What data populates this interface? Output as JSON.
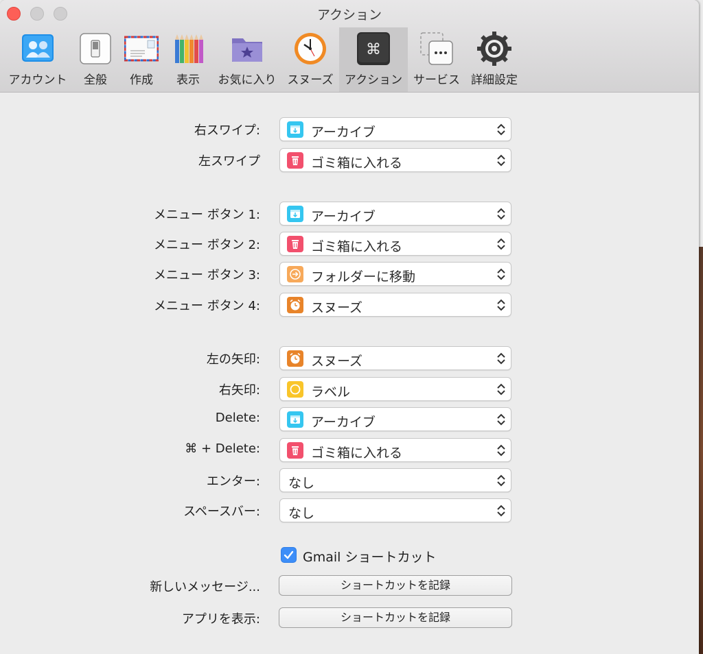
{
  "window": {
    "title": "アクション"
  },
  "tabs": [
    {
      "label": "アカウント",
      "icon": "accounts-icon"
    },
    {
      "label": "全般",
      "icon": "general-switch-icon"
    },
    {
      "label": "作成",
      "icon": "envelope-icon"
    },
    {
      "label": "表示",
      "icon": "pencils-icon"
    },
    {
      "label": "お気に入り",
      "icon": "favorites-folder-icon"
    },
    {
      "label": "スヌーズ",
      "icon": "snooze-clock-icon"
    },
    {
      "label": "アクション",
      "icon": "command-key-icon",
      "selected": true
    },
    {
      "label": "サービス",
      "icon": "services-icon"
    },
    {
      "label": "詳細設定",
      "icon": "advanced-gear-icon"
    }
  ],
  "swipe": {
    "right": {
      "label": "右スワイプ:",
      "value": "アーカイブ",
      "icon": "archive-icon"
    },
    "left": {
      "label": "左スワイプ",
      "value": "ゴミ箱に入れる",
      "icon": "trash-icon"
    }
  },
  "menu_buttons": [
    {
      "label": "メニュー ボタン 1:",
      "value": "アーカイブ",
      "icon": "archive-icon"
    },
    {
      "label": "メニュー ボタン 2:",
      "value": "ゴミ箱に入れる",
      "icon": "trash-icon"
    },
    {
      "label": "メニュー ボタン 3:",
      "value": "フォルダーに移動",
      "icon": "move-folder-icon"
    },
    {
      "label": "メニュー ボタン 4:",
      "value": "スヌーズ",
      "icon": "snooze-icon"
    }
  ],
  "keys": [
    {
      "label": "左の矢印:",
      "value": "スヌーズ",
      "icon": "snooze-icon"
    },
    {
      "label": "右矢印:",
      "value": "ラベル",
      "icon": "label-icon"
    },
    {
      "label": "Delete:",
      "value": "アーカイブ",
      "icon": "archive-icon"
    },
    {
      "label": "⌘ + Delete:",
      "value": "ゴミ箱に入れる",
      "icon": "trash-icon"
    },
    {
      "label": "エンター:",
      "value": "なし",
      "icon": ""
    },
    {
      "label": "スペースバー:",
      "value": "なし",
      "icon": ""
    }
  ],
  "gmail_shortcuts": {
    "label": "Gmail ショートカット",
    "checked": true
  },
  "shortcuts": [
    {
      "label": "新しいメッセージ...",
      "button": "ショートカットを記録"
    },
    {
      "label": "アプリを表示:",
      "button": "ショートカットを記録"
    }
  ],
  "colors": {
    "archive": "#35c6f0",
    "trash": "#f2506d",
    "move": "#f7a95a",
    "snooze": "#e8842a",
    "label": "#f9c52a",
    "checkbox": "#3d8ef8"
  }
}
